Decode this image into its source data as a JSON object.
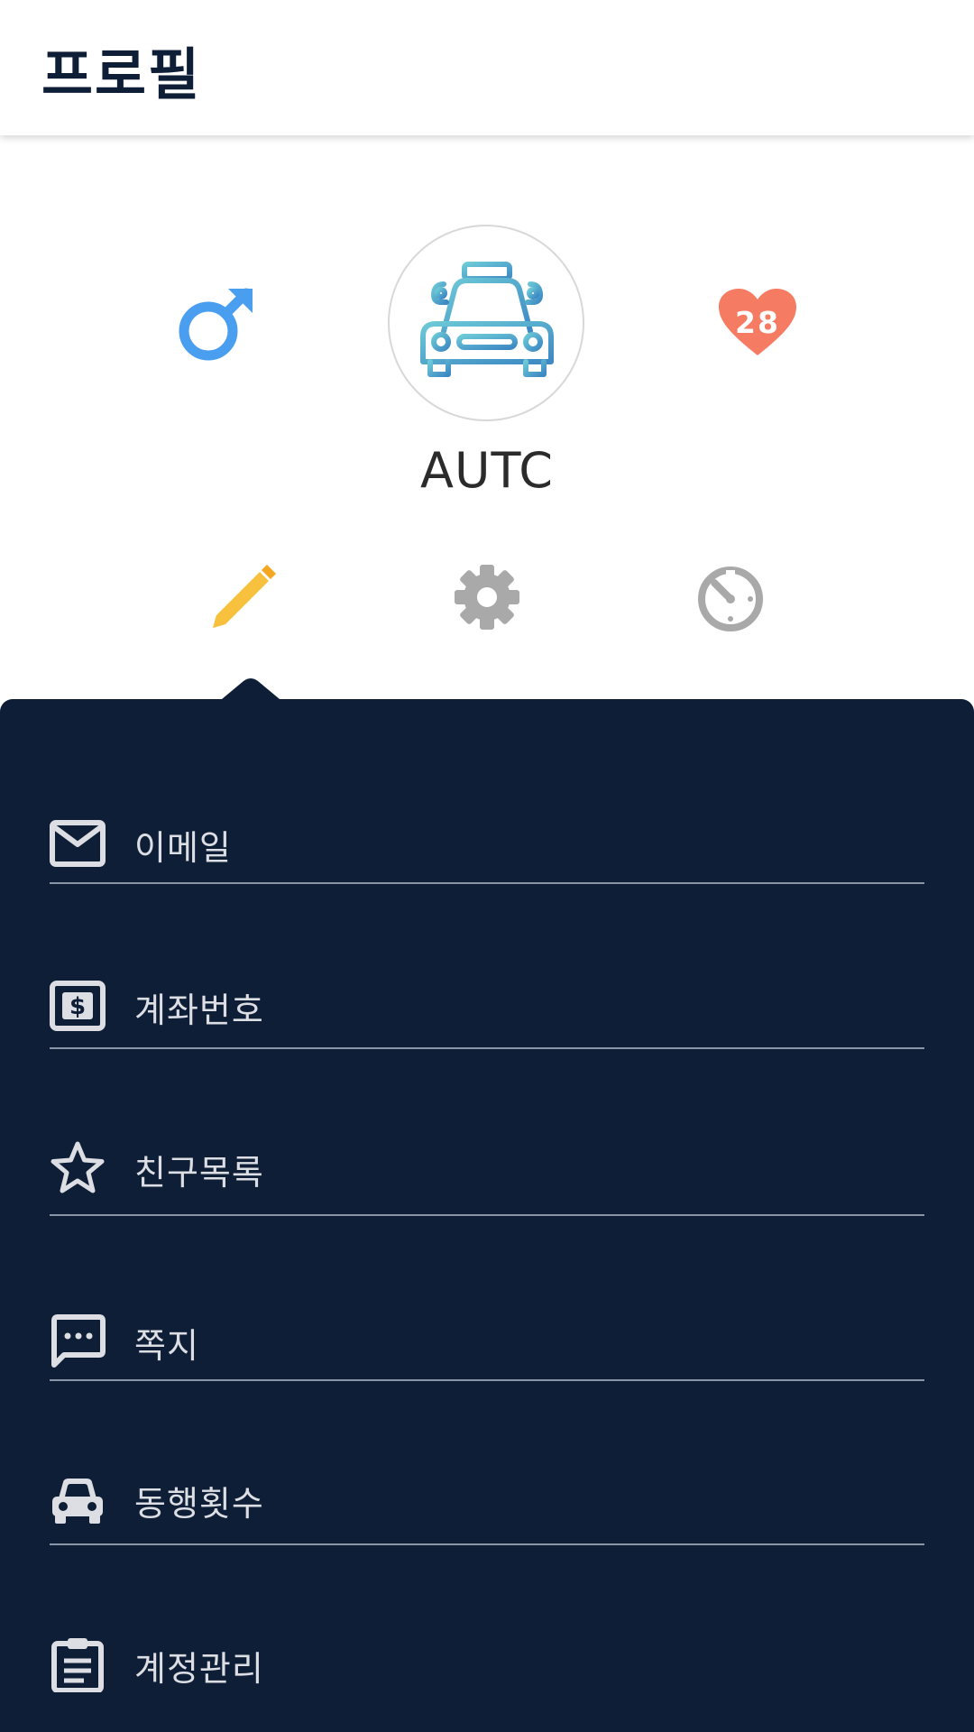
{
  "header": {
    "title": "프로필"
  },
  "profile": {
    "gender": "male",
    "avatar_icon": "taxi-icon",
    "heart_count": "28",
    "username": "AUTC",
    "actions": [
      {
        "name": "edit",
        "icon": "pencil-icon",
        "color": "#f8c13d",
        "selected": true
      },
      {
        "name": "settings",
        "icon": "gear-icon",
        "color": "#9a9a9a"
      },
      {
        "name": "timer",
        "icon": "timer-icon",
        "color": "#9a9a9a"
      }
    ]
  },
  "menu": {
    "items": [
      {
        "label": "이메일",
        "icon": "mail-icon"
      },
      {
        "label": "계좌번호",
        "icon": "dollar-card-icon"
      },
      {
        "label": "친구목록",
        "icon": "star-icon"
      },
      {
        "label": "쪽지",
        "icon": "message-icon"
      },
      {
        "label": "동행횟수",
        "icon": "car-icon"
      },
      {
        "label": "계정관리",
        "icon": "clipboard-icon"
      }
    ]
  },
  "colors": {
    "navy": "#0e1e37",
    "male_blue": "#4a9ef0",
    "heart_red": "#f57b62",
    "pencil_yellow": "#f8c13d",
    "icon_gray": "#a9a9a9",
    "menu_text": "#dcdee3"
  }
}
